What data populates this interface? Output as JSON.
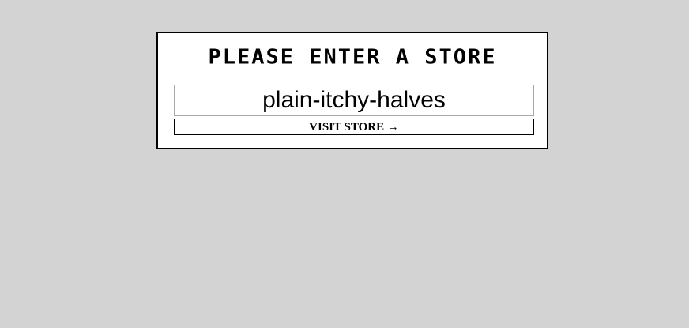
{
  "store_form": {
    "title": "Please enter a store",
    "input_value": "plain-itchy-halves",
    "button_label": "VISIT STORE →"
  },
  "colors": {
    "background": "#d3d3d3",
    "panel": "#ffffff",
    "border": "#000000",
    "input_border": "#a9a9a9"
  }
}
